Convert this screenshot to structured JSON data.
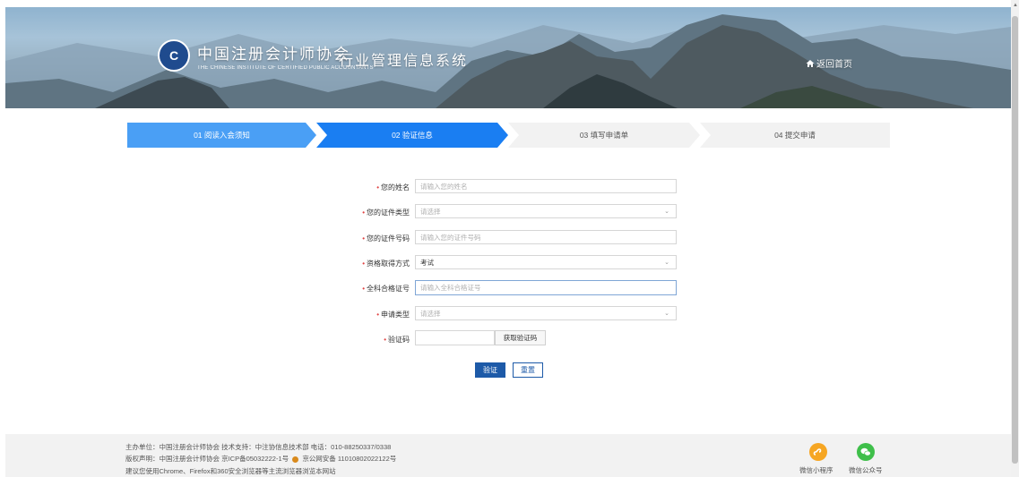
{
  "header": {
    "org_name_cn": "中国注册会计师协会",
    "org_name_en": "THE CHINESE INSTITUTE OF CERTIFIED PUBLIC ACCOUNTANTS",
    "system_title": "行业管理信息系统",
    "home_link": "返回首页"
  },
  "steps": [
    {
      "label": "01  阅读入会须知",
      "state": "done"
    },
    {
      "label": "02  验证信息",
      "state": "active"
    },
    {
      "label": "03  填写申请单",
      "state": "todo"
    },
    {
      "label": "04  提交申请",
      "state": "todo"
    }
  ],
  "form": {
    "name": {
      "label": "您的姓名",
      "placeholder": "请输入您的姓名",
      "value": ""
    },
    "id_type": {
      "label": "您的证件类型",
      "placeholder": "请选择",
      "value": ""
    },
    "id_number": {
      "label": "您的证件号码",
      "placeholder": "请输入您的证件号码",
      "value": ""
    },
    "qualification_method": {
      "label": "资格取得方式",
      "value": "考试"
    },
    "certificate_number": {
      "label": "全科合格证号",
      "placeholder": "请输入全科合格证号",
      "value": ""
    },
    "application_type": {
      "label": "申请类型",
      "placeholder": "请选择",
      "value": ""
    },
    "captcha": {
      "label": "验证码",
      "value": "",
      "get_code_label": "获取验证码"
    },
    "submit_label": "验证",
    "reset_label": "重置"
  },
  "footer": {
    "line1": "主办单位：中国注册会计师协会 技术支持：中注协信息技术部 电话：010-88250337/0338",
    "line2_a": "版权声明：中国注册会计师协会 京ICP备05032222-1号",
    "line2_b": "京公网安备 11010802022122号",
    "line3": "建议您使用Chrome、Firefox和360安全浏览器等主流浏览器浏览本网站",
    "mini_program": "微信小程序",
    "official_account": "微信公众号"
  },
  "colors": {
    "accent": "#1d5aa8",
    "step_done": "#4a9ff5",
    "step_active": "#1a7ef2",
    "step_todo": "#f2f2f2",
    "required": "#e04040"
  }
}
